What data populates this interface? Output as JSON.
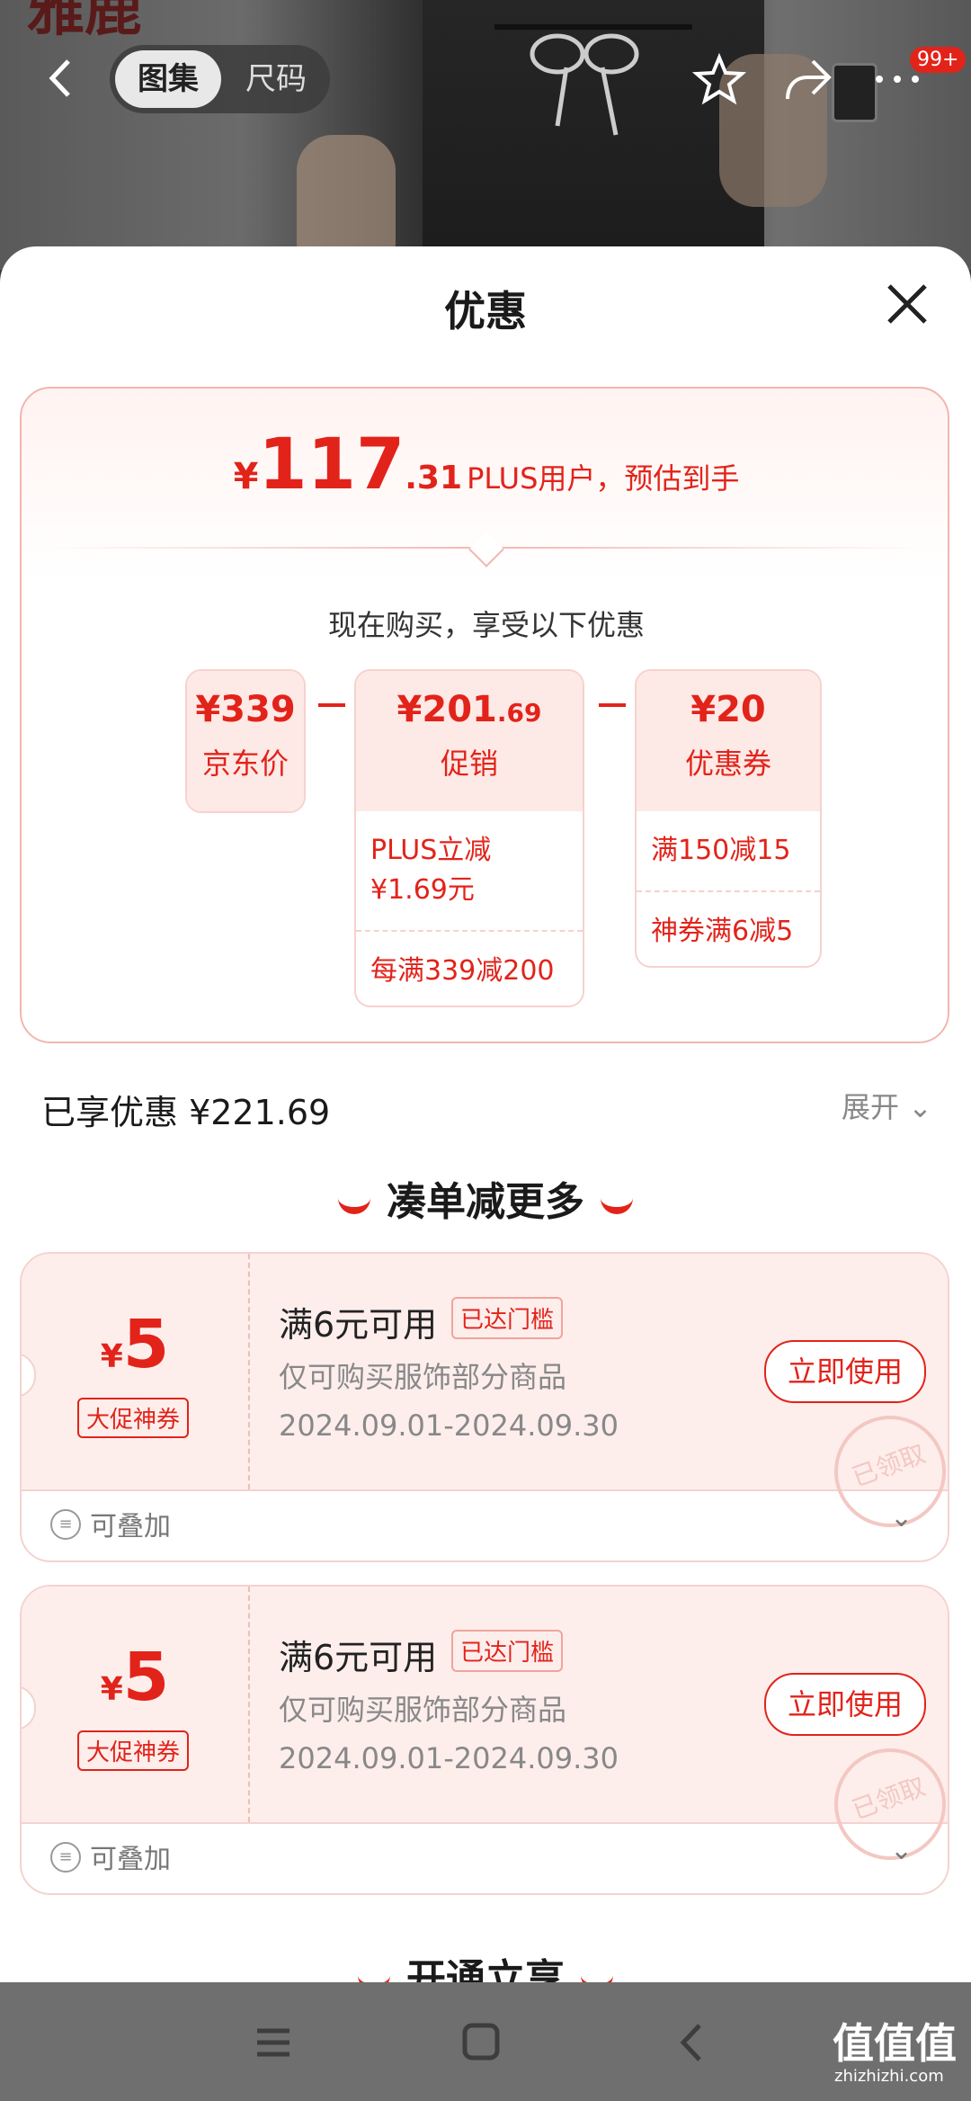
{
  "header": {
    "brand_text": "雅鹿",
    "segments": [
      "图集",
      "尺码"
    ],
    "badge": "99+"
  },
  "sheet": {
    "title": "优惠",
    "estimate": {
      "currency": "¥",
      "integer": "117",
      "decimal": ".31",
      "note": "PLUS用户，预估到手"
    },
    "now_buy_text": "现在购买，享受以下优惠",
    "breakdown": {
      "jd_price": {
        "amount": "¥339",
        "label": "京东价"
      },
      "promo": {
        "amount": "¥201",
        "amount_decimal": ".69",
        "label": "促销",
        "lines": [
          "PLUS立减\n¥1.69元",
          "每满339减200"
        ]
      },
      "coupon": {
        "amount": "¥20",
        "label": "优惠券",
        "lines": [
          "满150减15",
          "神券满6减5"
        ]
      }
    },
    "enjoyed_text": "已享优惠 ¥221.69",
    "expand_text": "展开 ⌄",
    "section1_title": "凑单减更多",
    "coupons": [
      {
        "currency": "¥",
        "value": "5",
        "tag": "大促神券",
        "condition": "满6元可用",
        "reach": "已达门槛",
        "scope": "仅可购买服饰部分商品",
        "date": "2024.09.01-2024.09.30",
        "button": "立即使用",
        "stamp": "已领取",
        "stack": "可叠加"
      },
      {
        "currency": "¥",
        "value": "5",
        "tag": "大促神券",
        "condition": "满6元可用",
        "reach": "已达门槛",
        "scope": "仅可购买服饰部分商品",
        "date": "2024.09.01-2024.09.30",
        "button": "立即使用",
        "stamp": "已领取",
        "stack": "可叠加"
      }
    ],
    "section2_title": "开通立享"
  },
  "watermark": {
    "text": "值值值",
    "sub": "zhizhizhi.com"
  },
  "colors": {
    "accent": "#e2231a",
    "sheet_bg": "#ffffff",
    "coupon_bg": "#fdeeec"
  }
}
